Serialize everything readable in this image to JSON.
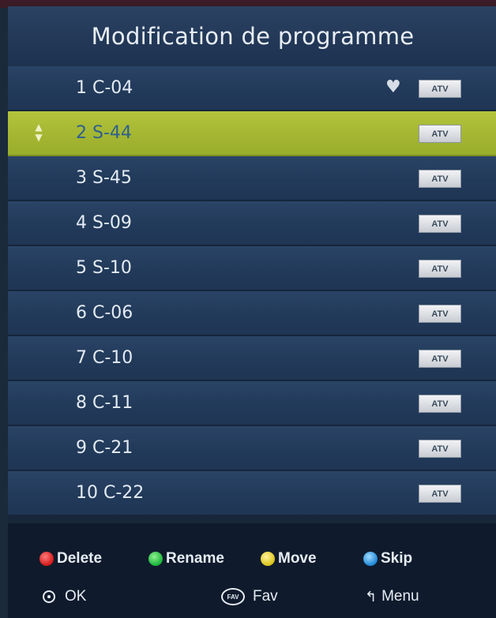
{
  "header": {
    "title": "Modification de programme"
  },
  "channels": [
    {
      "label": "1 C-04",
      "type": "ATV",
      "favorite": true,
      "selected": false
    },
    {
      "label": "2 S-44",
      "type": "ATV",
      "favorite": false,
      "selected": true
    },
    {
      "label": "3 S-45",
      "type": "ATV",
      "favorite": false,
      "selected": false
    },
    {
      "label": "4 S-09",
      "type": "ATV",
      "favorite": false,
      "selected": false
    },
    {
      "label": "5 S-10",
      "type": "ATV",
      "favorite": false,
      "selected": false
    },
    {
      "label": "6 C-06",
      "type": "ATV",
      "favorite": false,
      "selected": false
    },
    {
      "label": "7 C-10",
      "type": "ATV",
      "favorite": false,
      "selected": false
    },
    {
      "label": "8 C-11",
      "type": "ATV",
      "favorite": false,
      "selected": false
    },
    {
      "label": "9 C-21",
      "type": "ATV",
      "favorite": false,
      "selected": false
    },
    {
      "label": "10 C-22",
      "type": "ATV",
      "favorite": false,
      "selected": false
    }
  ],
  "footer": {
    "delete_label": "Delete",
    "rename_label": "Rename",
    "move_label": "Move",
    "skip_label": "Skip",
    "ok_label": "OK",
    "fav_label": "Fav",
    "fav_icon_text": "FAV",
    "menu_label": "Menu"
  },
  "colors": {
    "selected_row": "#a4b632",
    "row": "#223a5a",
    "delete": "#d21818",
    "rename": "#18b43a",
    "move": "#d9c21a",
    "skip": "#1f86d8"
  },
  "icons": {
    "favorite": "heart-icon",
    "move_indicator": "up-down-arrows-icon",
    "ok": "ok-button-icon",
    "fav": "fav-button-icon",
    "menu": "back-menu-icon"
  }
}
